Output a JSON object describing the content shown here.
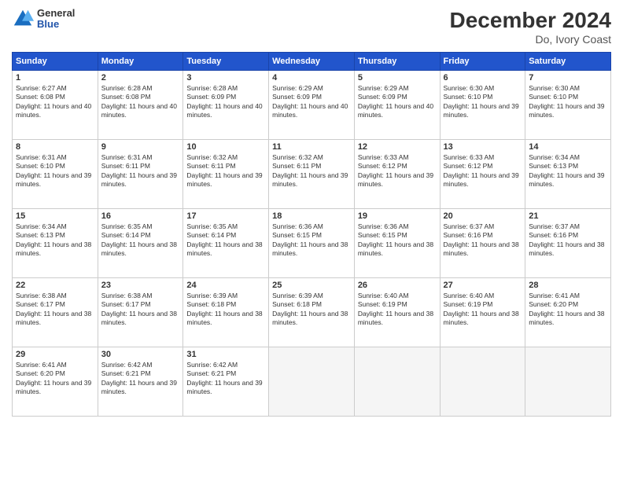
{
  "header": {
    "logo_general": "General",
    "logo_blue": "Blue",
    "month_title": "December 2024",
    "location": "Do, Ivory Coast"
  },
  "days_of_week": [
    "Sunday",
    "Monday",
    "Tuesday",
    "Wednesday",
    "Thursday",
    "Friday",
    "Saturday"
  ],
  "weeks": [
    [
      {
        "day": "1",
        "sunrise": "6:27 AM",
        "sunset": "6:08 PM",
        "daylight": "11 hours and 40 minutes."
      },
      {
        "day": "2",
        "sunrise": "6:28 AM",
        "sunset": "6:08 PM",
        "daylight": "11 hours and 40 minutes."
      },
      {
        "day": "3",
        "sunrise": "6:28 AM",
        "sunset": "6:09 PM",
        "daylight": "11 hours and 40 minutes."
      },
      {
        "day": "4",
        "sunrise": "6:29 AM",
        "sunset": "6:09 PM",
        "daylight": "11 hours and 40 minutes."
      },
      {
        "day": "5",
        "sunrise": "6:29 AM",
        "sunset": "6:09 PM",
        "daylight": "11 hours and 40 minutes."
      },
      {
        "day": "6",
        "sunrise": "6:30 AM",
        "sunset": "6:10 PM",
        "daylight": "11 hours and 39 minutes."
      },
      {
        "day": "7",
        "sunrise": "6:30 AM",
        "sunset": "6:10 PM",
        "daylight": "11 hours and 39 minutes."
      }
    ],
    [
      {
        "day": "8",
        "sunrise": "6:31 AM",
        "sunset": "6:10 PM",
        "daylight": "11 hours and 39 minutes."
      },
      {
        "day": "9",
        "sunrise": "6:31 AM",
        "sunset": "6:11 PM",
        "daylight": "11 hours and 39 minutes."
      },
      {
        "day": "10",
        "sunrise": "6:32 AM",
        "sunset": "6:11 PM",
        "daylight": "11 hours and 39 minutes."
      },
      {
        "day": "11",
        "sunrise": "6:32 AM",
        "sunset": "6:11 PM",
        "daylight": "11 hours and 39 minutes."
      },
      {
        "day": "12",
        "sunrise": "6:33 AM",
        "sunset": "6:12 PM",
        "daylight": "11 hours and 39 minutes."
      },
      {
        "day": "13",
        "sunrise": "6:33 AM",
        "sunset": "6:12 PM",
        "daylight": "11 hours and 39 minutes."
      },
      {
        "day": "14",
        "sunrise": "6:34 AM",
        "sunset": "6:13 PM",
        "daylight": "11 hours and 39 minutes."
      }
    ],
    [
      {
        "day": "15",
        "sunrise": "6:34 AM",
        "sunset": "6:13 PM",
        "daylight": "11 hours and 38 minutes."
      },
      {
        "day": "16",
        "sunrise": "6:35 AM",
        "sunset": "6:14 PM",
        "daylight": "11 hours and 38 minutes."
      },
      {
        "day": "17",
        "sunrise": "6:35 AM",
        "sunset": "6:14 PM",
        "daylight": "11 hours and 38 minutes."
      },
      {
        "day": "18",
        "sunrise": "6:36 AM",
        "sunset": "6:15 PM",
        "daylight": "11 hours and 38 minutes."
      },
      {
        "day": "19",
        "sunrise": "6:36 AM",
        "sunset": "6:15 PM",
        "daylight": "11 hours and 38 minutes."
      },
      {
        "day": "20",
        "sunrise": "6:37 AM",
        "sunset": "6:16 PM",
        "daylight": "11 hours and 38 minutes."
      },
      {
        "day": "21",
        "sunrise": "6:37 AM",
        "sunset": "6:16 PM",
        "daylight": "11 hours and 38 minutes."
      }
    ],
    [
      {
        "day": "22",
        "sunrise": "6:38 AM",
        "sunset": "6:17 PM",
        "daylight": "11 hours and 38 minutes."
      },
      {
        "day": "23",
        "sunrise": "6:38 AM",
        "sunset": "6:17 PM",
        "daylight": "11 hours and 38 minutes."
      },
      {
        "day": "24",
        "sunrise": "6:39 AM",
        "sunset": "6:18 PM",
        "daylight": "11 hours and 38 minutes."
      },
      {
        "day": "25",
        "sunrise": "6:39 AM",
        "sunset": "6:18 PM",
        "daylight": "11 hours and 38 minutes."
      },
      {
        "day": "26",
        "sunrise": "6:40 AM",
        "sunset": "6:19 PM",
        "daylight": "11 hours and 38 minutes."
      },
      {
        "day": "27",
        "sunrise": "6:40 AM",
        "sunset": "6:19 PM",
        "daylight": "11 hours and 38 minutes."
      },
      {
        "day": "28",
        "sunrise": "6:41 AM",
        "sunset": "6:20 PM",
        "daylight": "11 hours and 38 minutes."
      }
    ],
    [
      {
        "day": "29",
        "sunrise": "6:41 AM",
        "sunset": "6:20 PM",
        "daylight": "11 hours and 39 minutes."
      },
      {
        "day": "30",
        "sunrise": "6:42 AM",
        "sunset": "6:21 PM",
        "daylight": "11 hours and 39 minutes."
      },
      {
        "day": "31",
        "sunrise": "6:42 AM",
        "sunset": "6:21 PM",
        "daylight": "11 hours and 39 minutes."
      },
      null,
      null,
      null,
      null
    ]
  ]
}
